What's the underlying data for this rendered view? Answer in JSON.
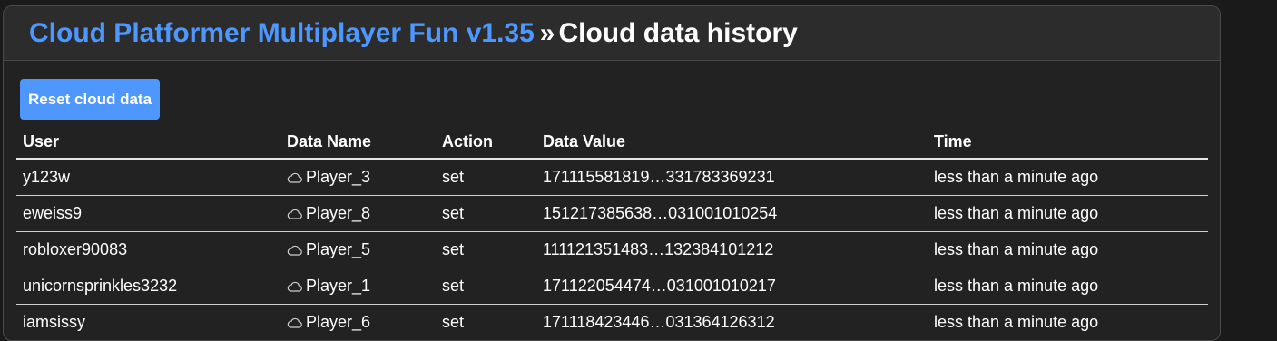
{
  "header": {
    "project_title": "Cloud Platformer Multiplayer Fun v1.35",
    "separator": "»",
    "page_title": "Cloud data history"
  },
  "actions": {
    "reset_label": "Reset cloud data"
  },
  "table": {
    "columns": [
      "User",
      "Data Name",
      "Action",
      "Data Value",
      "Time"
    ],
    "rows": [
      {
        "user": "y123w",
        "name": "Player_3",
        "action": "set",
        "value": "171115581819…331783369231",
        "time": "less than a minute ago"
      },
      {
        "user": "eweiss9",
        "name": "Player_8",
        "action": "set",
        "value": "151217385638…031001010254",
        "time": "less than a minute ago"
      },
      {
        "user": "robloxer90083",
        "name": "Player_5",
        "action": "set",
        "value": "111121351483…132384101212",
        "time": "less than a minute ago"
      },
      {
        "user": "unicornsprinkles3232",
        "name": "Player_1",
        "action": "set",
        "value": "171122054474…031001010217",
        "time": "less than a minute ago"
      },
      {
        "user": "iamsissy",
        "name": "Player_6",
        "action": "set",
        "value": "171118423446…031364126312",
        "time": "less than a minute ago"
      }
    ]
  },
  "icons": {
    "data_name_icon": "cloud-icon"
  },
  "colors": {
    "accent": "#4d97ff",
    "background": "#222222",
    "header_background": "#2c2c2c"
  }
}
